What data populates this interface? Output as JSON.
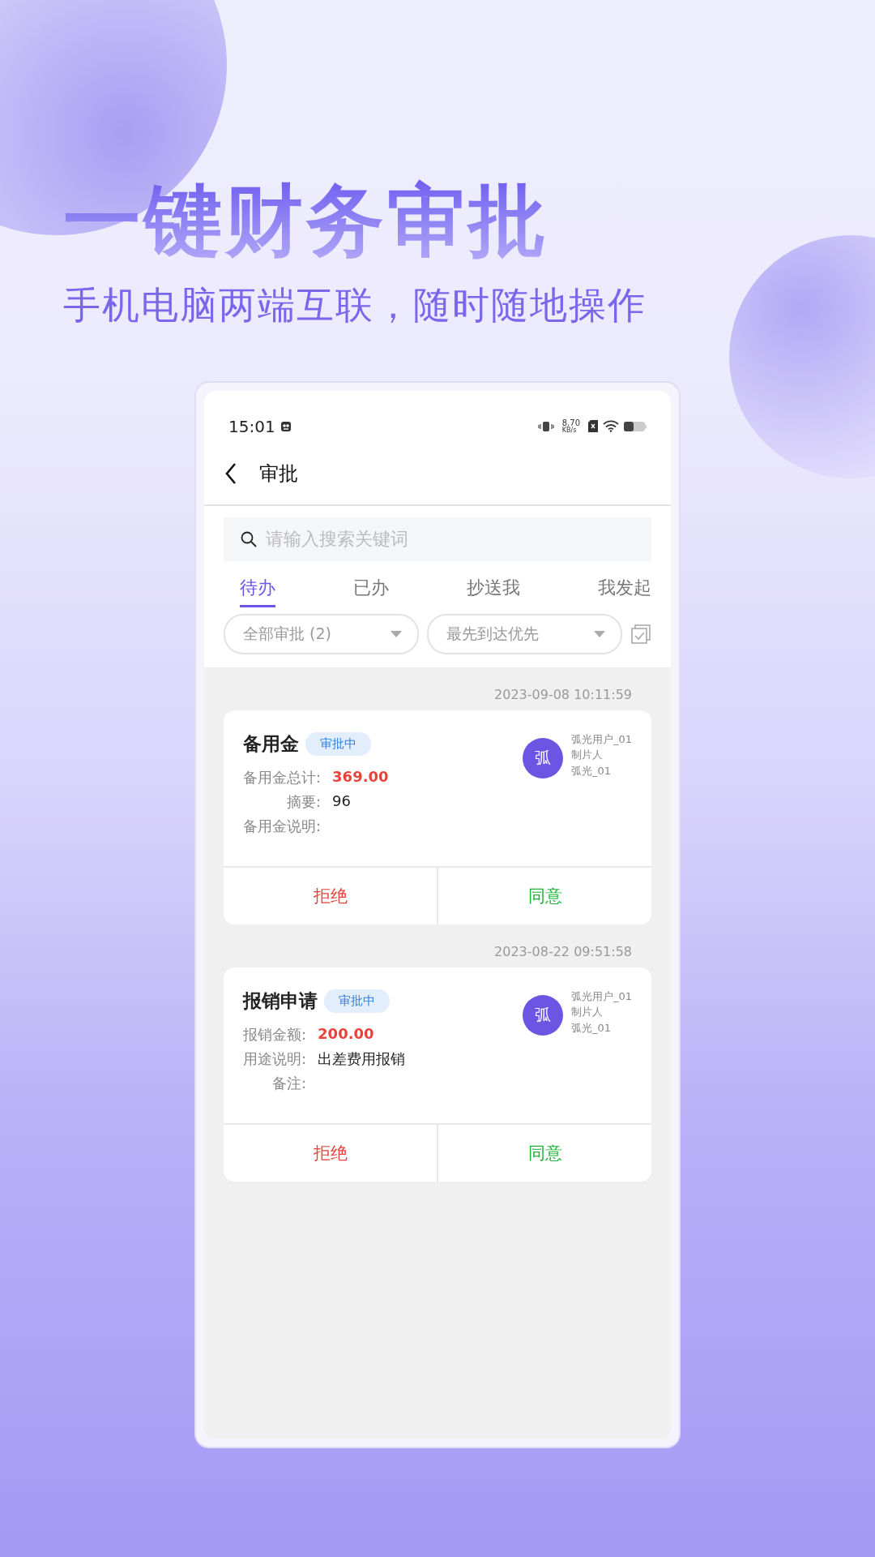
{
  "headline": "一键财务审批",
  "subtitle": "手机电脑两端互联，随时随地操作",
  "status_bar": {
    "time": "15:01",
    "speed_value": "8.70",
    "speed_unit": "KB/s"
  },
  "header": {
    "title": "审批"
  },
  "search": {
    "placeholder": "请输入搜索关键词"
  },
  "tabs": [
    {
      "label": "待办",
      "selected": true
    },
    {
      "label": "已办",
      "selected": false
    },
    {
      "label": "抄送我",
      "selected": false
    },
    {
      "label": "我发起",
      "selected": false
    }
  ],
  "filters": [
    {
      "label": "全部审批 (2)"
    },
    {
      "label": "最先到达优先"
    }
  ],
  "approvals": [
    {
      "time": "2023-09-08 10:11:59",
      "title": "备用金",
      "status": "审批中",
      "avatar": "弧",
      "user": "弧光用户_01",
      "role": "制片人",
      "dept": "弧光_01",
      "fields": [
        {
          "label": "备用金总计:",
          "value": "369.00",
          "kind": "amount"
        },
        {
          "label": "摘要:",
          "value": "96",
          "kind": "text"
        },
        {
          "label": "备用金说明:"
        }
      ],
      "actions": [
        {
          "label": "拒绝",
          "kind": "reject"
        },
        {
          "label": "同意",
          "kind": "approve"
        }
      ]
    },
    {
      "time": "2023-08-22 09:51:58",
      "title": "报销申请",
      "status": "审批中",
      "avatar": "弧",
      "user": "弧光用户_01",
      "role": "制片人",
      "dept": "弧光_01",
      "fields": [
        {
          "label": "报销金额:",
          "value": "200.00",
          "kind": "amount"
        },
        {
          "label": "用途说明:",
          "value": "出差费用报销",
          "kind": "text"
        },
        {
          "label": "备注:"
        }
      ],
      "actions": [
        {
          "label": "拒绝",
          "kind": "reject"
        },
        {
          "label": "同意",
          "kind": "approve"
        }
      ]
    }
  ]
}
